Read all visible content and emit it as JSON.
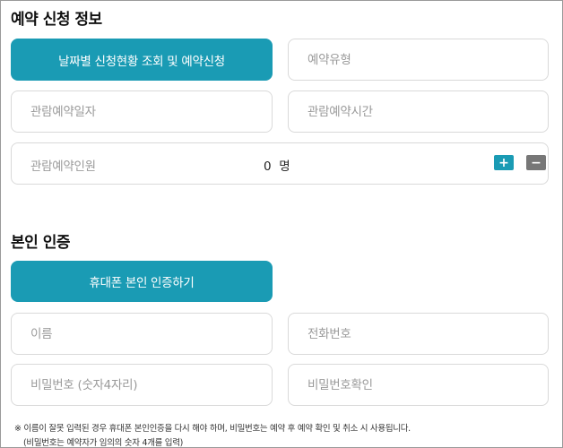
{
  "reservation": {
    "title": "예약 신청 정보",
    "date_button": "날짜별 신청현황 조회 및 예약신청",
    "type_placeholder": "예약유형",
    "date_placeholder": "관람예약일자",
    "time_placeholder": "관람예약시간",
    "people_label": "관람예약인원",
    "people_count": "0",
    "people_unit": "명",
    "plus_label": "+",
    "minus_label": "−"
  },
  "auth": {
    "title": "본인 인증",
    "phone_auth_button": "휴대폰 본인 인증하기",
    "name_placeholder": "이름",
    "phone_placeholder": "전화번호",
    "password_placeholder": "비밀번호 (숫자4자리)",
    "password_confirm_placeholder": "비밀번호확인"
  },
  "notice": {
    "line1": "※ 이름이 잘못 입력된 경우 휴대폰 본인인증을 다시 해야 하며, 비밀번호는 예약 후 예약 확인 및 취소 시 사용됩니다.",
    "line2": "(비밀번호는 예약자가 임의의 숫자 4개를 입력)"
  }
}
